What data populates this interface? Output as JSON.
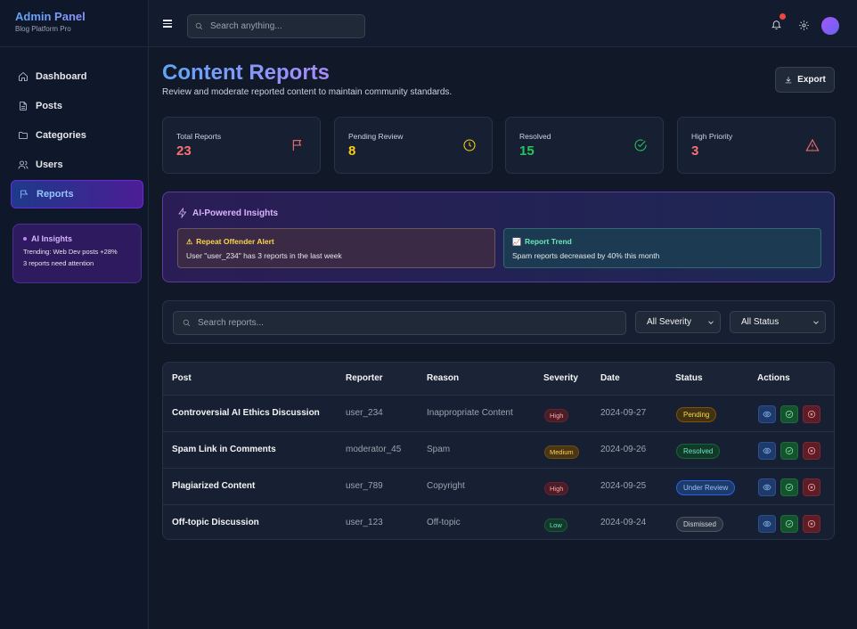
{
  "brand": {
    "title": "Admin Panel",
    "subtitle": "Blog Platform Pro"
  },
  "sidebar": {
    "items": [
      {
        "label": "Dashboard",
        "icon": "home-icon"
      },
      {
        "label": "Posts",
        "icon": "file-icon"
      },
      {
        "label": "Categories",
        "icon": "folder-icon"
      },
      {
        "label": "Users",
        "icon": "users-icon"
      },
      {
        "label": "Reports",
        "icon": "flag-icon",
        "active": true
      }
    ],
    "ai_insights": {
      "title": "AI Insights",
      "lines": [
        "Trending: Web Dev posts +28%",
        "3 reports need attention"
      ]
    }
  },
  "topbar": {
    "search_placeholder": "Search anything...",
    "has_notification": true
  },
  "page": {
    "title": "Content Reports",
    "subtitle": "Review and moderate reported content to maintain community standards.",
    "export_label": "Export"
  },
  "stats": [
    {
      "label": "Total Reports",
      "value": "23",
      "color": "#f87171",
      "icon": "flag-icon"
    },
    {
      "label": "Pending Review",
      "value": "8",
      "color": "#facc15",
      "icon": "clock-icon"
    },
    {
      "label": "Resolved",
      "value": "15",
      "color": "#22c55e",
      "icon": "check-circle-icon"
    },
    {
      "label": "High Priority",
      "value": "3",
      "color": "#f87171",
      "icon": "warning-icon"
    }
  ],
  "insights": {
    "title": "AI-Powered Insights",
    "alert": {
      "title": "Repeat Offender Alert",
      "text": "User \"user_234\" has 3 reports in the last week"
    },
    "trend": {
      "title": "Report Trend",
      "text": "Spam reports decreased by 40% this month"
    }
  },
  "filters": {
    "search_placeholder": "Search reports...",
    "severity": "All Severity",
    "status": "All Status"
  },
  "table": {
    "headers": [
      "Post",
      "Reporter",
      "Reason",
      "Severity",
      "Date",
      "Status",
      "Actions"
    ],
    "rows": [
      {
        "post": "Controversial AI Ethics Discussion",
        "reporter": "user_234",
        "reason": "Inappropriate Content",
        "severity": "High",
        "date": "2024-09-27",
        "status": "Pending"
      },
      {
        "post": "Spam Link in Comments",
        "reporter": "moderator_45",
        "reason": "Spam",
        "severity": "Medium",
        "date": "2024-09-26",
        "status": "Resolved"
      },
      {
        "post": "Plagiarized Content",
        "reporter": "user_789",
        "reason": "Copyright",
        "severity": "High",
        "date": "2024-09-25",
        "status": "Under Review"
      },
      {
        "post": "Off-topic Discussion",
        "reporter": "user_123",
        "reason": "Off-topic",
        "severity": "Low",
        "date": "2024-09-24",
        "status": "Dismissed"
      }
    ]
  }
}
